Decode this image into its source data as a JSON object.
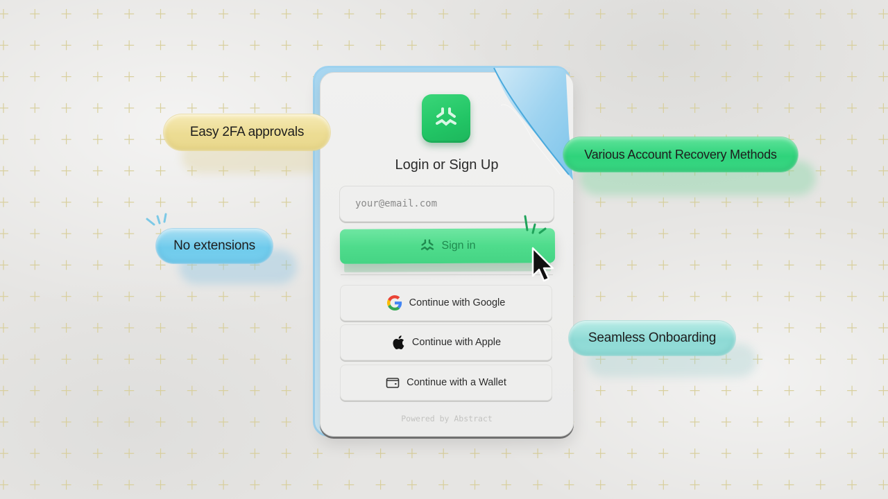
{
  "login_card": {
    "title": "Login or Sign Up",
    "email_placeholder": "your@email.com",
    "email_value": "",
    "sign_in_label": "Sign in",
    "social_buttons": [
      {
        "label": "Continue with Google",
        "icon": "google-icon"
      },
      {
        "label": "Continue with Apple",
        "icon": "apple-icon"
      },
      {
        "label": "Continue with a Wallet",
        "icon": "wallet-icon"
      }
    ],
    "footer": "Powered by Abstract",
    "logo_icon": "abstract-logo-icon"
  },
  "feature_pills": [
    {
      "label": "Easy 2FA approvals",
      "color": "#ecdc93"
    },
    {
      "label": "No extensions",
      "color": "#6fcbec"
    },
    {
      "label": "Various Account Recovery Methods",
      "color": "#2fd37b"
    },
    {
      "label": "Seamless Onboarding",
      "color": "#8edad5"
    }
  ],
  "colors": {
    "brand_green": "#22c565",
    "sign_in_green": "#4fdc8c",
    "background": "#e6e5e3",
    "grid_cross": "#d8cf9c"
  }
}
